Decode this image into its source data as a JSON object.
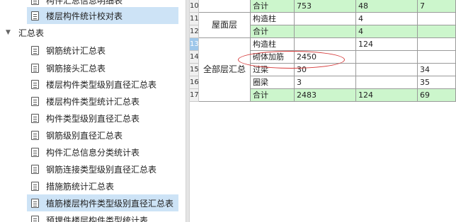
{
  "tree": {
    "items": [
      {
        "label": "构件汇总信息明细表",
        "level": "child"
      },
      {
        "label": "楼层构件统计校对表",
        "level": "child",
        "selected": true
      },
      {
        "label": "汇总表",
        "level": "parent",
        "expanded": true,
        "icon": "chevron-down-icon"
      },
      {
        "label": "钢筋统计汇总表",
        "level": "child"
      },
      {
        "label": "钢筋接头汇总表",
        "level": "child"
      },
      {
        "label": "楼层构件类型级别直径汇总表",
        "level": "child"
      },
      {
        "label": "楼层构件类型统计汇总表",
        "level": "child"
      },
      {
        "label": "构件类型级别直径汇总表",
        "level": "child"
      },
      {
        "label": "钢筋级别直径汇总表",
        "level": "child"
      },
      {
        "label": "构件汇总信息分类统计表",
        "level": "child"
      },
      {
        "label": "钢筋连接类型级别直径汇总表",
        "level": "child"
      },
      {
        "label": "措施筋统计汇总表",
        "level": "child"
      },
      {
        "label": "植筋楼层构件类型级别直径汇总表",
        "level": "child",
        "selected": true
      },
      {
        "label": "预埋件楼层构件类型统计表",
        "level": "child"
      }
    ]
  },
  "table": {
    "row_numbers": [
      "10",
      "11",
      "12",
      "13",
      "14",
      "15",
      "16",
      "17"
    ],
    "active_row": "13",
    "group_labels": {
      "roof": "屋面层",
      "all": "全部层汇总"
    },
    "rows": [
      {
        "type": "合计",
        "c1": "753",
        "c2": "48",
        "c3": "7",
        "green": true
      },
      {
        "type": "构造柱",
        "c1": "",
        "c2": "4",
        "c3": "",
        "green": false
      },
      {
        "type": "合计",
        "c1": "",
        "c2": "4",
        "c3": "",
        "green": true
      },
      {
        "type": "构造柱",
        "c1": "",
        "c2": "124",
        "c3": "",
        "green": false
      },
      {
        "type": "砌体加筋",
        "c1": "2450",
        "c2": "",
        "c3": "",
        "green": false
      },
      {
        "type": "过梁",
        "c1": "30",
        "c2": "",
        "c3": "34",
        "green": false
      },
      {
        "type": "圈梁",
        "c1": "3",
        "c2": "",
        "c3": "35",
        "green": false
      },
      {
        "type": "合计",
        "c1": "2483",
        "c2": "124",
        "c3": "69",
        "green": true
      }
    ]
  },
  "colors": {
    "selection": "#cde3f6",
    "subtotal_row": "#ccf6cc",
    "active_row_header": "#9ec7ea",
    "annotation": "#d63a3a"
  }
}
